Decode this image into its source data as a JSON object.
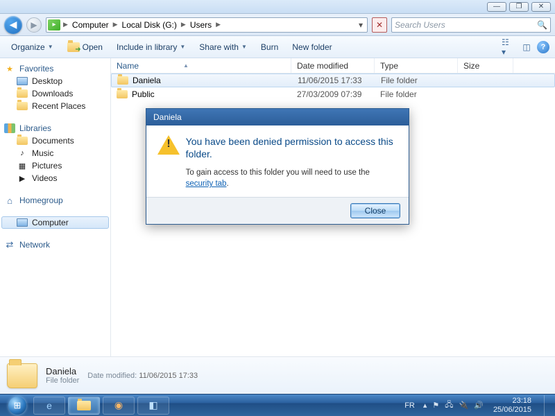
{
  "window_controls": {
    "min": "—",
    "max": "❐",
    "close": "✕"
  },
  "breadcrumbs": [
    "Computer",
    "Local Disk (G:)",
    "Users"
  ],
  "search": {
    "placeholder": "Search Users"
  },
  "toolbar": {
    "organize": "Organize",
    "open": "Open",
    "include": "Include in library",
    "share": "Share with",
    "burn": "Burn",
    "newfolder": "New folder"
  },
  "navpane": {
    "favorites": {
      "label": "Favorites",
      "items": [
        "Desktop",
        "Downloads",
        "Recent Places"
      ]
    },
    "libraries": {
      "label": "Libraries",
      "items": [
        "Documents",
        "Music",
        "Pictures",
        "Videos"
      ]
    },
    "homegroup": "Homegroup",
    "computer": "Computer",
    "network": "Network"
  },
  "columns": {
    "name": "Name",
    "date": "Date modified",
    "type": "Type",
    "size": "Size"
  },
  "rows": [
    {
      "name": "Daniela",
      "date": "11/06/2015 17:33",
      "type": "File folder",
      "size": ""
    },
    {
      "name": "Public",
      "date": "27/03/2009 07:39",
      "type": "File folder",
      "size": ""
    }
  ],
  "dialog": {
    "title": "Daniela",
    "heading": "You have been denied permission to access this folder.",
    "body_pre": "To gain access to this folder you will need to use the ",
    "link": "security tab",
    "body_post": ".",
    "close": "Close"
  },
  "details": {
    "name": "Daniela",
    "type": "File folder",
    "date_label": "Date modified:",
    "date": "11/06/2015 17:33"
  },
  "tray": {
    "lang": "FR",
    "time": "23:18",
    "date": "25/06/2015"
  }
}
